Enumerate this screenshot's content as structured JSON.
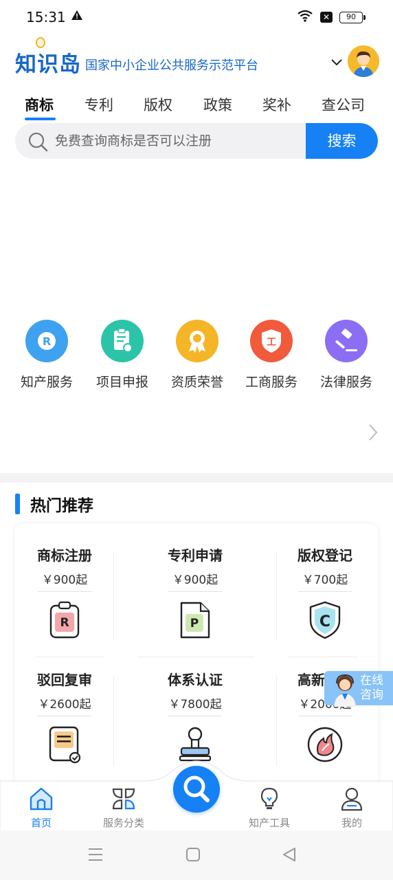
{
  "status_bar": {
    "time": "15:31",
    "battery": "90"
  },
  "header": {
    "logo": "知识岛",
    "slogan": "国家中小企业公共服务示范平台"
  },
  "tabs": [
    {
      "label": "商标"
    },
    {
      "label": "专利"
    },
    {
      "label": "版权"
    },
    {
      "label": "政策"
    },
    {
      "label": "奖补"
    },
    {
      "label": "查公司"
    }
  ],
  "search": {
    "placeholder": "免费查询商标是否可以注册",
    "button_label": "搜索"
  },
  "services": [
    {
      "label": "知产服务",
      "icon": "registered-r-icon",
      "color": "#3fa2f0"
    },
    {
      "label": "项目申报",
      "icon": "document-icon",
      "color": "#2cc4a8"
    },
    {
      "label": "资质荣誉",
      "icon": "award-icon",
      "color": "#f4b526"
    },
    {
      "label": "工商服务",
      "icon": "shield-icon",
      "color": "#f25a3c"
    },
    {
      "label": "法律服务",
      "icon": "gavel-icon",
      "color": "#8b6ef3"
    }
  ],
  "hot": {
    "title": "热门推荐",
    "products": [
      {
        "name": "商标注册",
        "price": "￥900起",
        "icon": "trademark-clipboard-icon"
      },
      {
        "name": "专利申请",
        "price": "￥900起",
        "icon": "patent-document-icon"
      },
      {
        "name": "版权登记",
        "price": "￥700起",
        "icon": "copyright-shield-icon"
      },
      {
        "name": "驳回复审",
        "price": "￥2600起",
        "icon": "review-document-icon"
      },
      {
        "name": "体系认证",
        "price": "￥7800起",
        "icon": "stamp-icon"
      },
      {
        "name": "高新认证",
        "price": "￥2000起",
        "icon": "flame-badge-icon"
      }
    ]
  },
  "consult": {
    "line1": "在线",
    "line2": "咨询"
  },
  "bottom_nav": [
    {
      "label": "首页",
      "icon": "home-icon"
    },
    {
      "label": "服务分类",
      "icon": "category-icon"
    },
    {
      "label": "知产工具",
      "icon": "bulb-icon"
    },
    {
      "label": "我的",
      "icon": "user-icon"
    }
  ],
  "colors": {
    "accent": "#1680f5",
    "brand": "#1767c9"
  }
}
